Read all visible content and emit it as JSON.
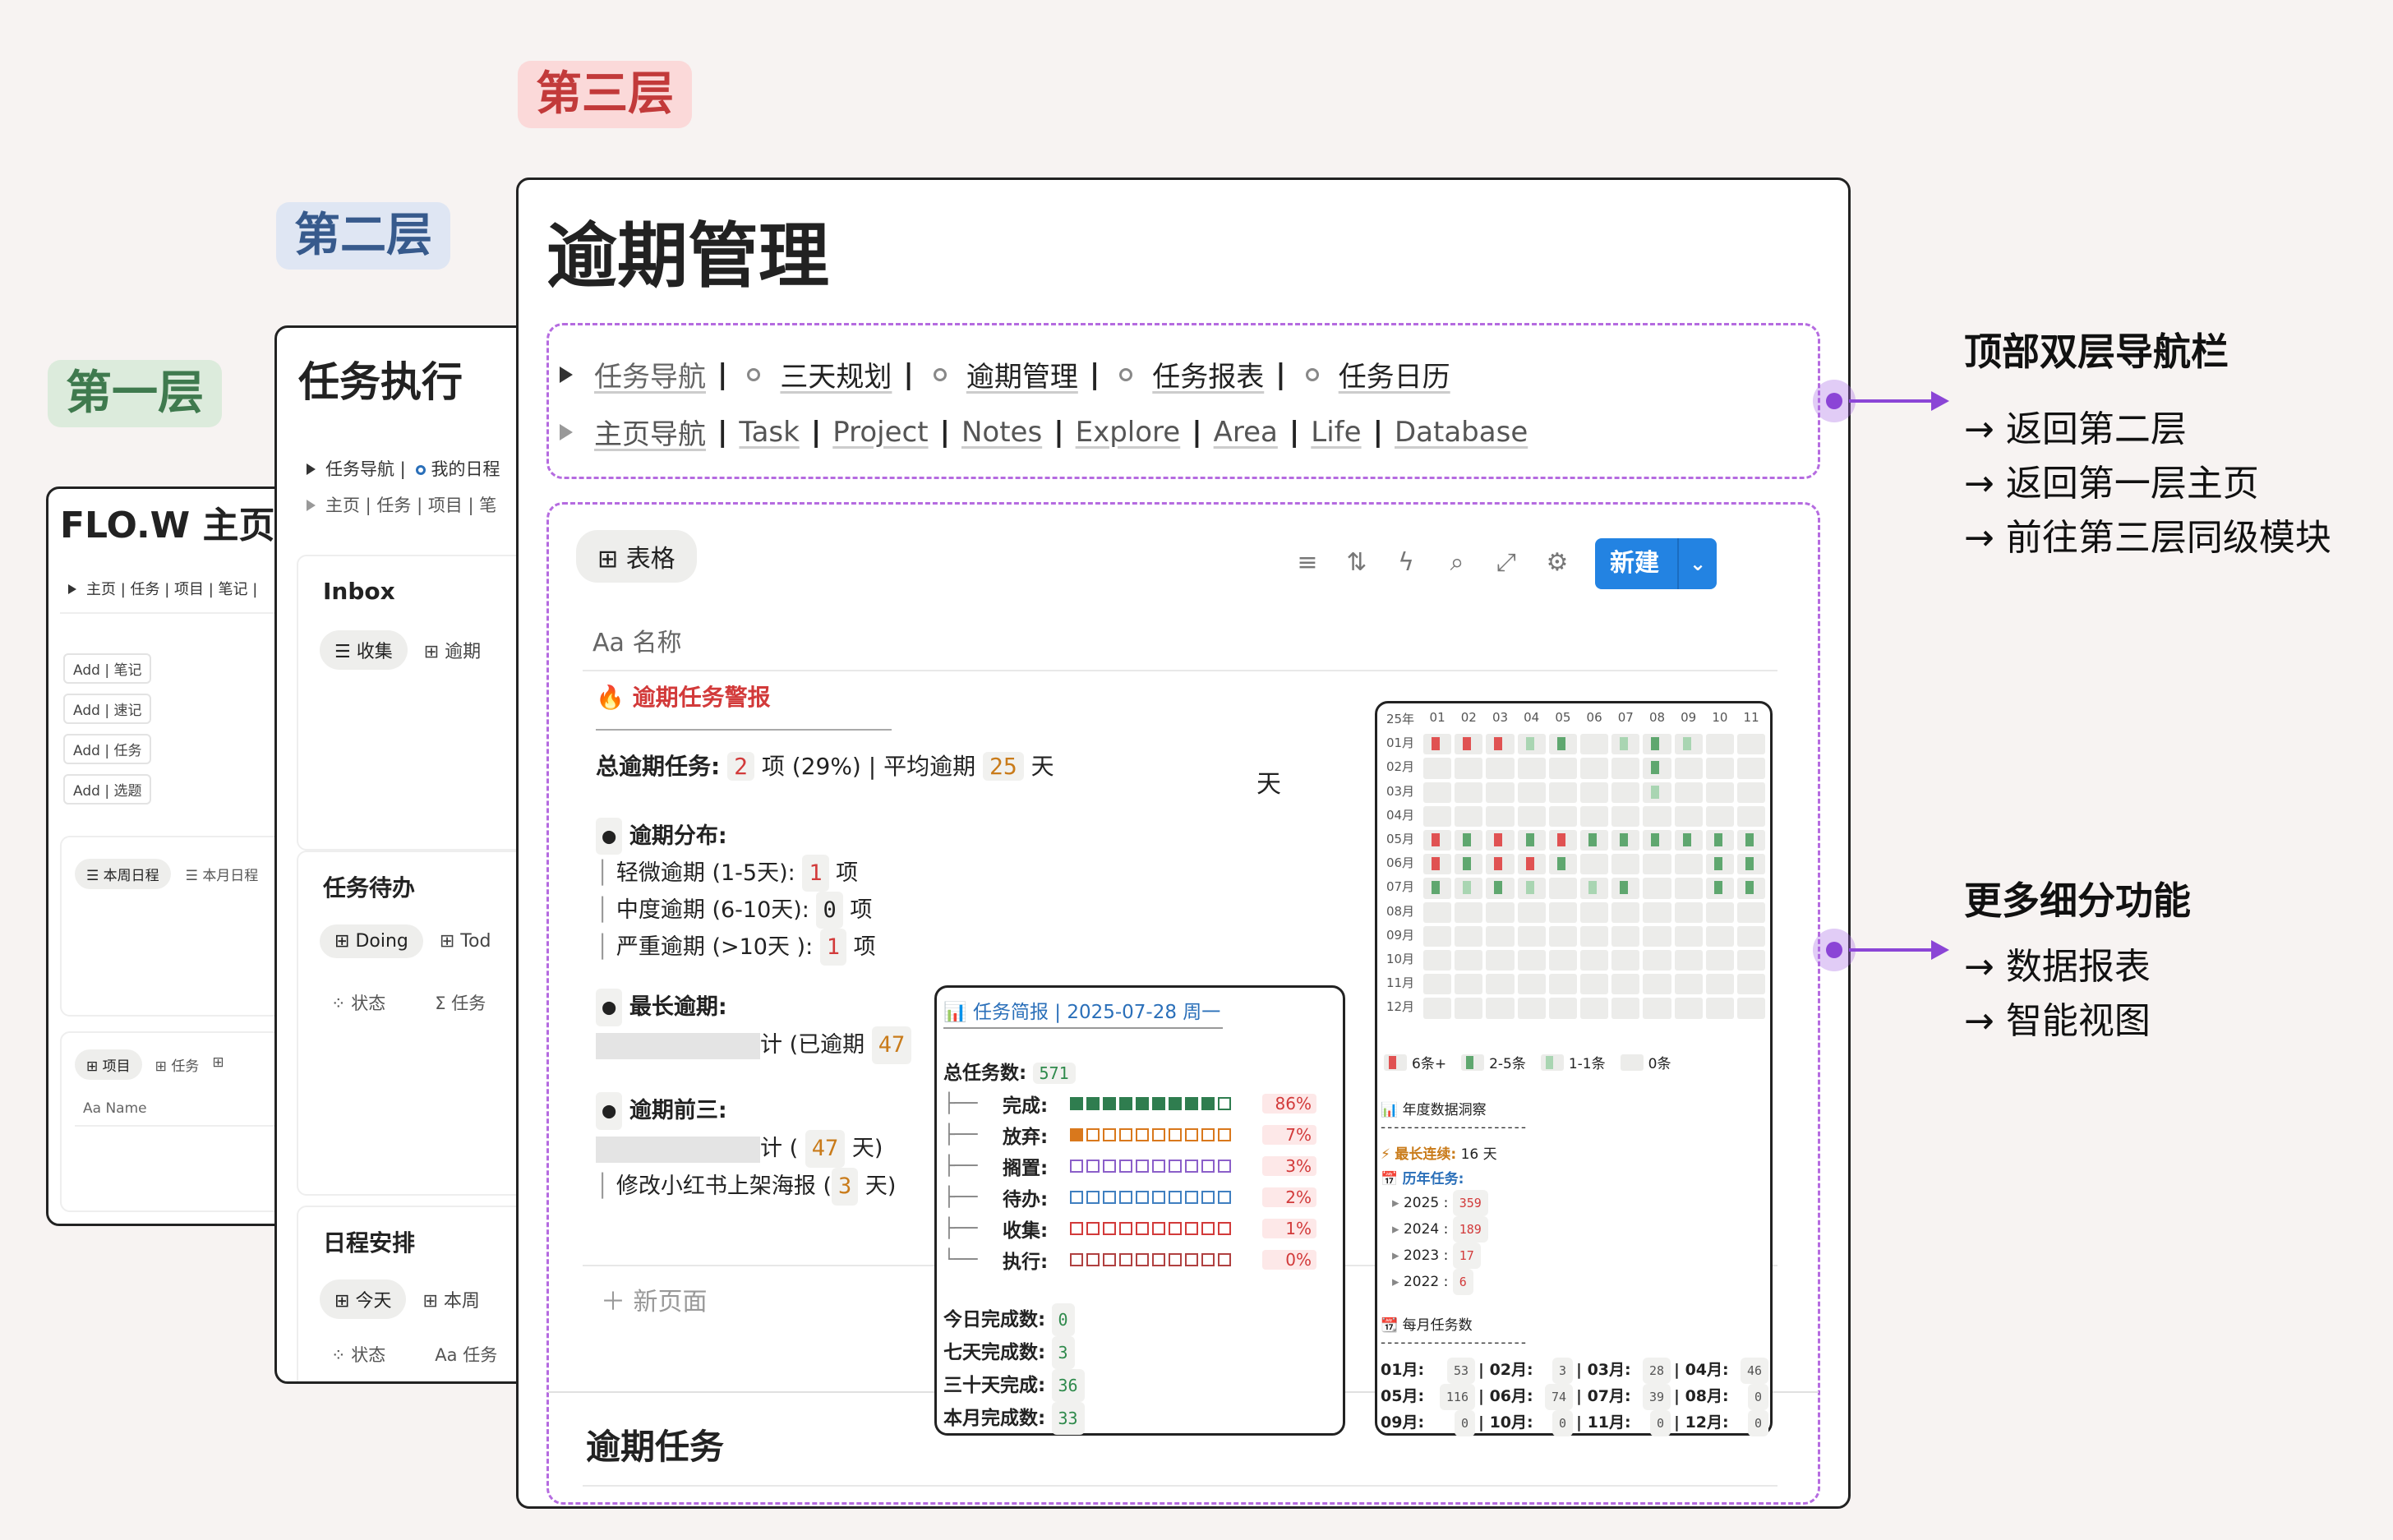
{
  "layers": {
    "first": "第一层",
    "second": "第二层",
    "third": "第三层"
  },
  "flow": {
    "title": "FLO.W 主页",
    "nav": "主页 | 任务 | 项目 | 笔记 |",
    "add_buttons": [
      "Add | 笔记",
      "Add | 速记",
      "Add | 任务",
      "Add | 选题"
    ],
    "views1": [
      "本周日程",
      "本月日程"
    ],
    "views2": [
      "项目",
      "任务"
    ],
    "name_col": "Name"
  },
  "task": {
    "title": "任务执行",
    "nav1_a": "任务导航 |",
    "nav1_b": "我的日程",
    "nav2": "主页 | 任务 | 项目 | 笔",
    "inbox": "Inbox",
    "inbox_views": [
      "收集",
      "逾期"
    ],
    "todo": "任务待办",
    "todo_views": [
      "Doing",
      "Tod"
    ],
    "todo_props": [
      "状态",
      "任务"
    ],
    "sched": "日程安排",
    "sched_views": [
      "今天",
      "本周"
    ],
    "sched_props": [
      "状态",
      "任务"
    ]
  },
  "main": {
    "title": "逾期管理",
    "nav_row1": [
      "任务导航",
      "三天规划",
      "逾期管理",
      "任务报表",
      "任务日历"
    ],
    "nav_row2": [
      "主页导航",
      "Task",
      "Project",
      "Notes",
      "Explore",
      "Area",
      "Life",
      "Database"
    ],
    "view_label": "表格",
    "new_btn": "新建",
    "name_col": "名称",
    "new_page": "新页面",
    "section2": "逾期任务",
    "stray": "天"
  },
  "report": {
    "alert": "🔥 逾期任务警报",
    "total_label": "总逾期任务:",
    "total_val": "2",
    "total_unit": "项 (29%) | 平均逾期",
    "avg_val": "25",
    "avg_unit": "天",
    "dist_label": "逾期分布:",
    "dist": [
      {
        "label": "轻微逾期 (1-5天):",
        "val": "1",
        "unit": "项"
      },
      {
        "label": "中度逾期 (6-10天):",
        "val": "0",
        "unit": "项"
      },
      {
        "label": "严重逾期 (>10天 ):",
        "val": "1",
        "unit": "项"
      }
    ],
    "longest_label": "最长逾期:",
    "longest_suffix": "计 (已逾期",
    "longest_val": "47",
    "top3_label": "逾期前三:",
    "top3": [
      {
        "name": "",
        "suffix": "计 (",
        "val": "47",
        "unit": "天)"
      },
      {
        "name": "修改小红书上架海报 (",
        "suffix": "",
        "val": "3",
        "unit": "天)"
      }
    ]
  },
  "brief": {
    "title": "任务简报 | 2025-07-28 周一",
    "total_label": "总任务数:",
    "total_val": "571",
    "rows": [
      {
        "label": "完成:",
        "pct": "86%",
        "filled": 9,
        "color": "#2f7d4f"
      },
      {
        "label": "放弃:",
        "pct": "7%",
        "filled": 1,
        "color": "#d9781c"
      },
      {
        "label": "搁置:",
        "pct": "3%",
        "filled": 0,
        "color": "#8b5fc9"
      },
      {
        "label": "待办:",
        "pct": "2%",
        "filled": 0,
        "color": "#3f7fc0"
      },
      {
        "label": "收集:",
        "pct": "1%",
        "filled": 0,
        "color": "#d23a3a"
      },
      {
        "label": "执行:",
        "pct": "0%",
        "filled": 0,
        "color": "#b04040"
      }
    ],
    "stats": [
      {
        "label": "今日完成数:",
        "val": "0"
      },
      {
        "label": "七天完成数:",
        "val": "3"
      },
      {
        "label": "三十天完成:",
        "val": "36"
      },
      {
        "label": "本月完成数:",
        "val": "33"
      }
    ]
  },
  "heatmap": {
    "corner": "25年",
    "cols": [
      "01",
      "02",
      "03",
      "04",
      "05",
      "06",
      "07",
      "08",
      "09",
      "10",
      "11"
    ],
    "rows": [
      "01月",
      "02月",
      "03月",
      "04月",
      "05月",
      "06月",
      "07月",
      "08月",
      "09月",
      "10月",
      "11月",
      "12月"
    ],
    "legend": [
      "6条+",
      "2-5条",
      "1-1条",
      "0条"
    ],
    "insight_title": "年度数据洞察",
    "streak_label": "最长连续:",
    "streak_val": "16 天",
    "history_label": "历年任务:",
    "years": [
      {
        "y": "2025 :",
        "v": "359"
      },
      {
        "y": "2024 :",
        "v": "189"
      },
      {
        "y": "2023 :",
        "v": "17"
      },
      {
        "y": "2022 :",
        "v": "6"
      }
    ],
    "monthly_title": "每月任务数",
    "months": [
      {
        "m": "01月:",
        "v": "53"
      },
      {
        "m": "02月:",
        "v": "3"
      },
      {
        "m": "03月:",
        "v": "28"
      },
      {
        "m": "04月:",
        "v": "46"
      },
      {
        "m": "05月:",
        "v": "116"
      },
      {
        "m": "06月:",
        "v": "74"
      },
      {
        "m": "07月:",
        "v": "39"
      },
      {
        "m": "08月:",
        "v": "0"
      },
      {
        "m": "09月:",
        "v": "0"
      },
      {
        "m": "10月:",
        "v": "0"
      },
      {
        "m": "11月:",
        "v": "0"
      },
      {
        "m": "12月:",
        "v": "0"
      }
    ],
    "colors": {
      "high": "#e05252",
      "mid": "#5fa76f",
      "low": "#a9d5b2",
      "none": "#ececea"
    }
  },
  "right": {
    "nav_title": "顶部双层导航栏",
    "nav_items": [
      "→ 返回第二层",
      "→ 返回第一层主页",
      "→ 前往第三层同级模块"
    ],
    "more_title": "更多细分功能",
    "more_items": [
      "→ 数据报表",
      "→ 智能视图"
    ]
  }
}
